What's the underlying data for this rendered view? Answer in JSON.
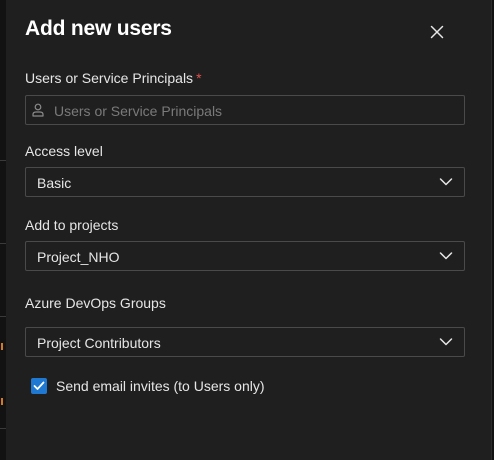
{
  "dialog": {
    "title": "Add new users",
    "close_icon": "close-icon"
  },
  "users_field": {
    "label": "Users or Service Principals",
    "required_marker": "*",
    "placeholder": "Users or Service Principals",
    "value": "",
    "icon": "person-icon"
  },
  "access_level": {
    "label": "Access level",
    "value": "Basic",
    "icon": "chevron-down-icon"
  },
  "projects": {
    "label": "Add to projects",
    "value": "Project_NHO",
    "icon": "chevron-down-icon"
  },
  "groups": {
    "label": "Azure DevOps Groups",
    "value": "Project Contributors",
    "icon": "chevron-down-icon"
  },
  "email_invites": {
    "label": "Send email invites (to Users only)",
    "checked": true,
    "icon": "checkmark-icon"
  },
  "colors": {
    "panel_bg": "#1f1f1f",
    "accent": "#1f78d1",
    "required": "#e0524e",
    "border": "#4a4a4a"
  }
}
